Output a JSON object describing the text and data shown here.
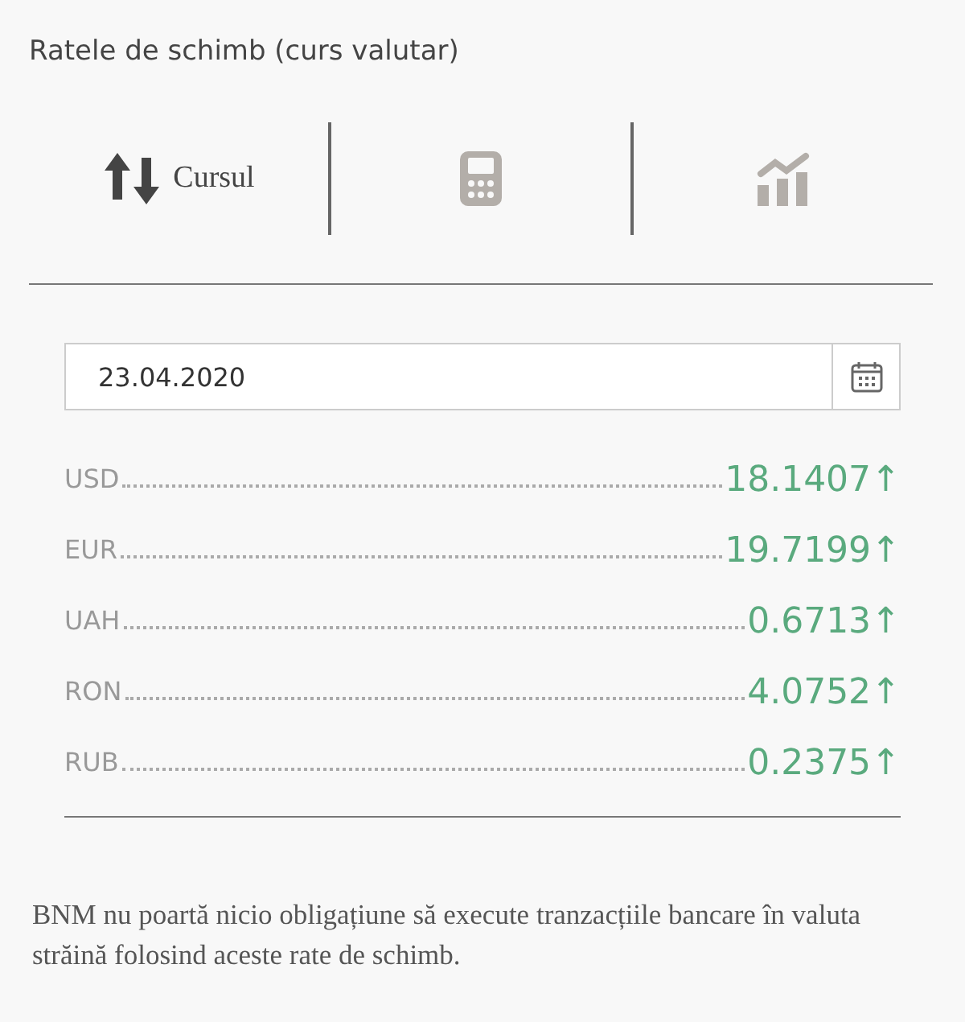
{
  "title": "Ratele de schimb (curs valutar)",
  "tabs": [
    {
      "kind": "exchange",
      "label": "Cursul",
      "selected": true
    },
    {
      "kind": "calculator",
      "selected": false
    },
    {
      "kind": "chart",
      "selected": false
    }
  ],
  "date_field": {
    "value": "23.04.2020"
  },
  "rates": [
    {
      "currency": "USD",
      "value": "18.1407",
      "trend": "↑"
    },
    {
      "currency": "EUR",
      "value": "19.7199",
      "trend": "↑"
    },
    {
      "currency": "UAH",
      "value": "0.6713",
      "trend": "↑"
    },
    {
      "currency": "RON",
      "value": "4.0752",
      "trend": "↑"
    },
    {
      "currency": "RUB",
      "value": "0.2375",
      "trend": "↑"
    }
  ],
  "disclaimer": "BNM nu poartă nicio obligațiune să execute tranzacțiile bancare în valuta străină folosind aceste rate de schimb."
}
